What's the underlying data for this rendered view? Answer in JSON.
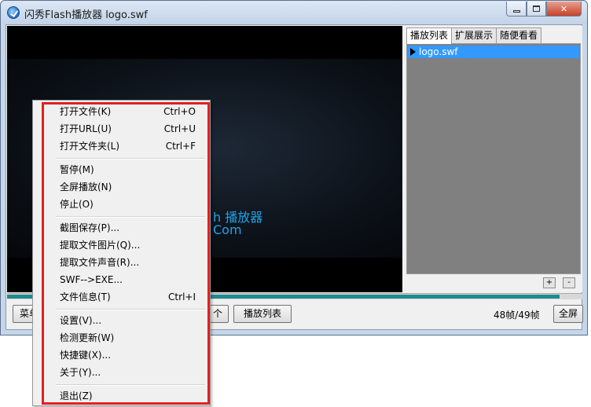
{
  "window": {
    "title": "闪秀Flash播放器  logo.swf"
  },
  "player": {
    "brand_line1": "h 播放器",
    "brand_line2": "Com"
  },
  "panel": {
    "tabs": [
      "播放列表",
      "扩展展示",
      "随便看看"
    ],
    "playlist_items": [
      "logo.swf"
    ],
    "add_label": "+",
    "remove_label": "-"
  },
  "progress": {
    "fraction": 0.96
  },
  "bottom_bar": {
    "menu_label": "菜单",
    "hidden_button_label": "个",
    "playlist_label": "播放列表",
    "frame_counter": "48帧/49帧",
    "fullscreen_label": "全屏"
  },
  "context_menu": {
    "items": [
      {
        "label": "打开文件(K)",
        "shortcut": "Ctrl+O"
      },
      {
        "label": "打开URL(U)",
        "shortcut": "Ctrl+U"
      },
      {
        "label": "打开文件夹(L)",
        "shortcut": "Ctrl+F"
      },
      {
        "label": "暂停(M)",
        "shortcut": ""
      },
      {
        "label": "全屏播放(N)",
        "shortcut": ""
      },
      {
        "label": "停止(O)",
        "shortcut": ""
      },
      {
        "label": "截图保存(P)...",
        "shortcut": ""
      },
      {
        "label": "提取文件图片(Q)...",
        "shortcut": ""
      },
      {
        "label": "提取文件声音(R)...",
        "shortcut": ""
      },
      {
        "label": "SWF-->EXE...",
        "shortcut": ""
      },
      {
        "label": "文件信息(T)",
        "shortcut": "Ctrl+I"
      },
      {
        "label": "设置(V)...",
        "shortcut": ""
      },
      {
        "label": "检测更新(W)",
        "shortcut": ""
      },
      {
        "label": "快捷键(X)...",
        "shortcut": ""
      },
      {
        "label": "关于(Y)...",
        "shortcut": ""
      },
      {
        "label": "退出(Z)",
        "shortcut": ""
      }
    ]
  },
  "colors": {
    "highlight_box": "#e02020",
    "selection": "#3399ff",
    "brand_text": "#1fa3e6"
  }
}
